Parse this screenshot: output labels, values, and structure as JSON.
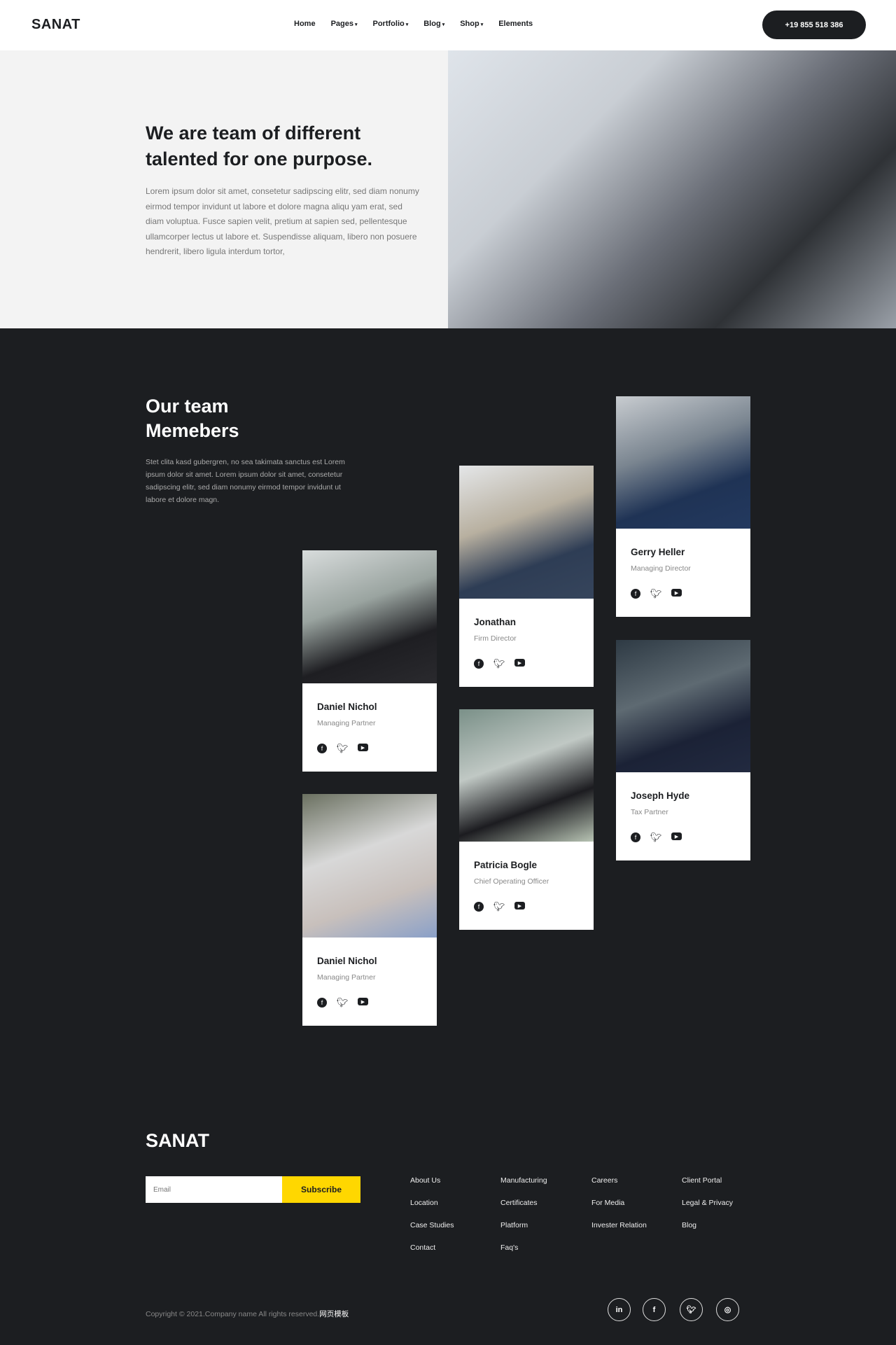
{
  "header": {
    "logo": "SANAT",
    "nav": [
      {
        "label": "Home",
        "dropdown": false
      },
      {
        "label": "Pages",
        "dropdown": true
      },
      {
        "label": "Portfolio",
        "dropdown": true
      },
      {
        "label": "Blog",
        "dropdown": true
      },
      {
        "label": "Shop",
        "dropdown": true
      },
      {
        "label": "Elements",
        "dropdown": false
      }
    ],
    "phone": "+19 855 518 386"
  },
  "hero": {
    "title": "We are team of different talented for one purpose.",
    "text": "Lorem ipsum dolor sit amet, consetetur sadipscing elitr, sed diam nonumy eirmod tempor invidunt ut labore et dolore magna aliqu yam erat, sed diam voluptua. Fusce sapien velit, pretium at sapien sed, pellentesque ullamcorper lectus ut labore et. Suspendisse aliquam, libero non posuere hendrerit, libero ligula interdum tortor,"
  },
  "team": {
    "title": "Our team Memebers",
    "text": "Stet clita kasd gubergren, no sea takimata sanctus est Lorem ipsum dolor sit amet. Lorem ipsum dolor sit amet, consetetur sadipscing elitr, sed diam nonumy eirmod tempor invidunt ut labore et dolore magn.",
    "members": [
      {
        "name": "Gerry Heller",
        "role": "Managing Director"
      },
      {
        "name": "Jonathan",
        "role": "Firm Director"
      },
      {
        "name": "Daniel Nichol",
        "role": "Managing Partner"
      },
      {
        "name": "Joseph Hyde",
        "role": "Tax Partner"
      },
      {
        "name": "Patricia Bogle",
        "role": "Chief Operating Officer"
      },
      {
        "name": "Daniel Nichol",
        "role": "Managing Partner"
      }
    ]
  },
  "footer": {
    "logo": "SANAT",
    "email_placeholder": "Email",
    "subscribe": "Subscribe",
    "columns": [
      [
        "About Us",
        "Location",
        "Case Studies",
        "Contact"
      ],
      [
        "Manufacturing",
        "Certificates",
        "Platform",
        "Faq's"
      ],
      [
        "Careers",
        "For Media",
        "Invester Relation"
      ],
      [
        "Client Portal",
        "Legal & Privacy",
        "Blog"
      ]
    ],
    "copyright": "Copyright © 2021.Company name All rights reserved.",
    "copyright_link": "网页模板",
    "social": [
      "linkedin",
      "facebook",
      "twitter",
      "instagram"
    ]
  },
  "colors": {
    "dark": "#1c1e21",
    "accent": "#ffd700"
  }
}
